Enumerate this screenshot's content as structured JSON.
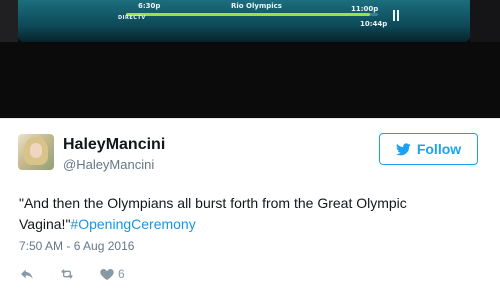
{
  "photo": {
    "start_time": "6:30p",
    "program_title": "Rio Olympics",
    "end_time": "11:00p",
    "current_time": "10:44p",
    "brand": "DIRECTV",
    "progress_fraction": 0.97,
    "colors": {
      "panel": "#155e6e",
      "progress": "#9fe04a"
    }
  },
  "tweet": {
    "display_name": "HaleyMancini",
    "handle": "@HaleyMancini",
    "follow_label": "Follow",
    "text_main": "\"And then the Olympians all burst forth from the Great Olympic Vagina!\"",
    "hashtag": "#OpeningCeremony",
    "timestamp": "7:50 AM - 6 Aug 2016",
    "like_count": "6",
    "icons": [
      "reply-icon",
      "retweet-icon",
      "heart-icon",
      "twitter-bird-icon"
    ],
    "colors": {
      "accent": "#1da1f2",
      "text": "#14171a",
      "muted": "#657786",
      "icon": "#8899a6"
    }
  }
}
